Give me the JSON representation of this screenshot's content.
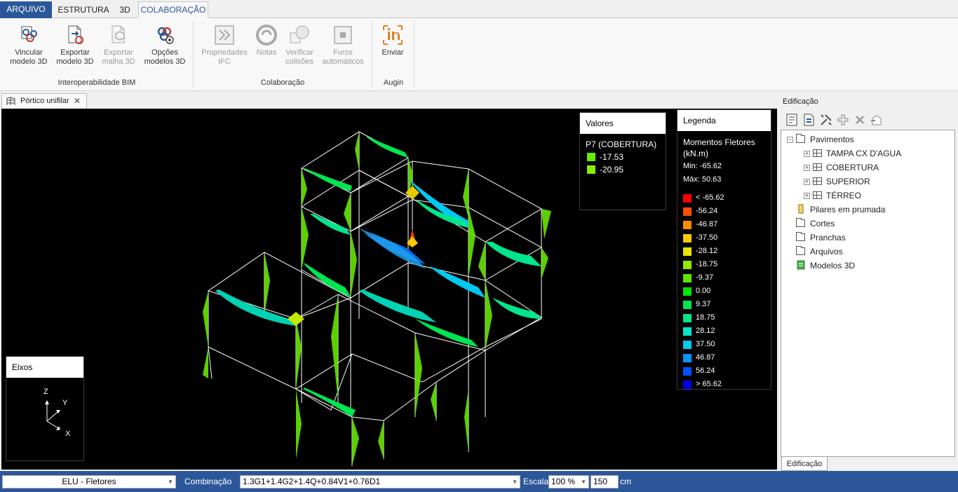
{
  "menu": {
    "tabs": [
      "ARQUIVO",
      "ESTRUTURA",
      "3D",
      "COLABORAÇÃO"
    ]
  },
  "ribbon": {
    "groups": [
      {
        "label": "Interoperabilidade BIM",
        "buttons": [
          {
            "line1": "Vincular",
            "line2": "modelo 3D",
            "enabled": true
          },
          {
            "line1": "Exportar",
            "line2": "modelo 3D",
            "enabled": true
          },
          {
            "line1": "Exportar",
            "line2": "malha 3D",
            "enabled": false
          },
          {
            "line1": "Opções",
            "line2": "modelos 3D",
            "enabled": true
          }
        ]
      },
      {
        "label": "Colaboração",
        "buttons": [
          {
            "line1": "Propriedades",
            "line2": "IFC",
            "enabled": false
          },
          {
            "line1": "Notas",
            "line2": "",
            "enabled": false
          },
          {
            "line1": "Verificar",
            "line2": "colisões",
            "enabled": false
          },
          {
            "line1": "Furos",
            "line2": "automáticos",
            "enabled": false
          }
        ]
      },
      {
        "label": "Augin",
        "buttons": [
          {
            "line1": "Enviar",
            "line2": "",
            "enabled": true
          }
        ]
      }
    ]
  },
  "document": {
    "tab_title": "Pórtico unifilar",
    "close_glyph": "✕"
  },
  "valores": {
    "header": "Valores",
    "element": "P7 (COBERTURA)",
    "items": [
      {
        "value": "-17.53",
        "color": "#66ee00"
      },
      {
        "value": "-20.95",
        "color": "#88ee00"
      }
    ]
  },
  "legenda": {
    "header": "Legenda",
    "title": "Momentos Fletores",
    "unit": "(kN.m)",
    "min": "Min: -65.62",
    "max": "Máx: 50.63",
    "entries": [
      {
        "label": "< -65.62",
        "color": "#ff0000"
      },
      {
        "label": "-56.24",
        "color": "#ff5000"
      },
      {
        "label": "-46.87",
        "color": "#ff8c00"
      },
      {
        "label": "-37.50",
        "color": "#ffc800"
      },
      {
        "label": "-28.12",
        "color": "#e6e600"
      },
      {
        "label": "-18.75",
        "color": "#96e600"
      },
      {
        "label": "-9.37",
        "color": "#5ae600"
      },
      {
        "label": "0.00",
        "color": "#00e600"
      },
      {
        "label": "9.37",
        "color": "#00e650"
      },
      {
        "label": "18.75",
        "color": "#00e68c"
      },
      {
        "label": "28.12",
        "color": "#00e6c8"
      },
      {
        "label": "37.50",
        "color": "#00c8f0"
      },
      {
        "label": "46.87",
        "color": "#0096ff"
      },
      {
        "label": "56.24",
        "color": "#0050ff"
      },
      {
        "label": "> 65.62",
        "color": "#0000e6"
      }
    ]
  },
  "eixos": {
    "header": "Eixos",
    "z": "Z",
    "y": "Y",
    "x": "X"
  },
  "side": {
    "title": "Edificação",
    "tab": "Edificação",
    "tree": {
      "root": "Pavimentos",
      "pavimentos": [
        "TAMPA CX D'AGUA",
        "COBERTURA",
        "SUPERIOR",
        "TÉRREO"
      ],
      "others": [
        "Pilares em prumada",
        "Cortes",
        "Pranchas",
        "Arquivos",
        "Modelos 3D"
      ]
    }
  },
  "statusbar": {
    "type_select": "ELU - Fletores",
    "combinacao_label": "Combinação",
    "combinacao_value": "1.3G1+1.4G2+1.4Q+0.84V1+0.76D1",
    "escala_label": "Escala",
    "escala_value": "100 %",
    "scale_input": "150",
    "unit": "cm"
  }
}
